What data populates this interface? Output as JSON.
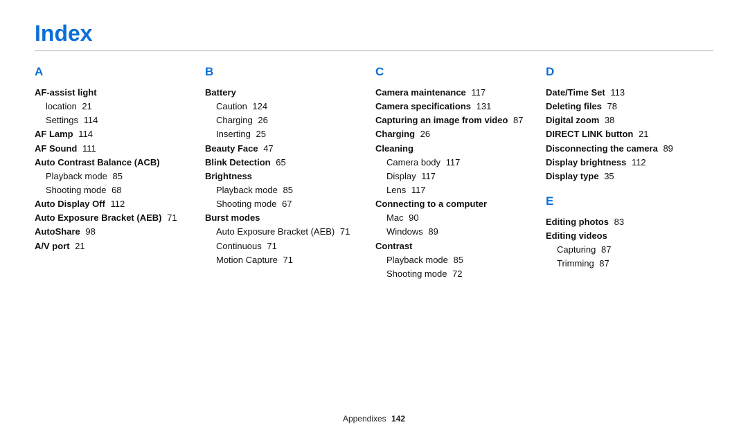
{
  "title": "Index",
  "footer": {
    "section": "Appendixes",
    "page": "142"
  },
  "columns": [
    {
      "letter": "A",
      "entries": [
        {
          "label": "AF-assist light",
          "page": null,
          "subs": [
            {
              "label": "location",
              "page": "21"
            },
            {
              "label": "Settings",
              "page": "114"
            }
          ]
        },
        {
          "label": "AF Lamp",
          "page": "114"
        },
        {
          "label": "AF Sound",
          "page": "111"
        },
        {
          "label": "Auto Contrast Balance (ACB)",
          "page": null,
          "subs": [
            {
              "label": "Playback mode",
              "page": "85"
            },
            {
              "label": "Shooting mode",
              "page": "68"
            }
          ]
        },
        {
          "label": "Auto Display Off",
          "page": "112"
        },
        {
          "label": "Auto Exposure Bracket (AEB)",
          "page": "71"
        },
        {
          "label": "AutoShare",
          "page": "98"
        },
        {
          "label": "A/V port",
          "page": "21"
        }
      ]
    },
    {
      "letter": "B",
      "entries": [
        {
          "label": "Battery",
          "page": null,
          "subs": [
            {
              "label": "Caution",
              "page": "124"
            },
            {
              "label": "Charging",
              "page": "26"
            },
            {
              "label": "Inserting",
              "page": "25"
            }
          ]
        },
        {
          "label": "Beauty Face",
          "page": "47"
        },
        {
          "label": "Blink Detection",
          "page": "65"
        },
        {
          "label": "Brightness",
          "page": null,
          "subs": [
            {
              "label": "Playback mode",
              "page": "85"
            },
            {
              "label": "Shooting mode",
              "page": "67"
            }
          ]
        },
        {
          "label": "Burst modes",
          "page": null,
          "subs": [
            {
              "label": "Auto Exposure Bracket (AEB)",
              "page": "71"
            },
            {
              "label": "Continuous",
              "page": "71"
            },
            {
              "label": "Motion Capture",
              "page": "71"
            }
          ]
        }
      ]
    },
    {
      "letter": "C",
      "entries": [
        {
          "label": "Camera maintenance",
          "page": "117"
        },
        {
          "label": "Camera specifications",
          "page": "131"
        },
        {
          "label": "Capturing an image from video",
          "page": "87"
        },
        {
          "label": "Charging",
          "page": "26"
        },
        {
          "label": "Cleaning",
          "page": null,
          "subs": [
            {
              "label": "Camera body",
              "page": "117"
            },
            {
              "label": "Display",
              "page": "117"
            },
            {
              "label": "Lens",
              "page": "117"
            }
          ]
        },
        {
          "label": "Connecting to a computer",
          "page": null,
          "subs": [
            {
              "label": "Mac",
              "page": "90"
            },
            {
              "label": "Windows",
              "page": "89"
            }
          ]
        },
        {
          "label": "Contrast",
          "page": null,
          "subs": [
            {
              "label": "Playback mode",
              "page": "85"
            },
            {
              "label": "Shooting mode",
              "page": "72"
            }
          ]
        }
      ]
    },
    {
      "groups": [
        {
          "letter": "D",
          "entries": [
            {
              "label": "Date/Time Set",
              "page": "113"
            },
            {
              "label": "Deleting files",
              "page": "78"
            },
            {
              "label": "Digital zoom",
              "page": "38"
            },
            {
              "label": "DIRECT LINK button",
              "page": "21"
            },
            {
              "label": "Disconnecting the camera",
              "page": "89"
            },
            {
              "label": "Display brightness",
              "page": "112"
            },
            {
              "label": "Display type",
              "page": "35"
            }
          ]
        },
        {
          "letter": "E",
          "entries": [
            {
              "label": "Editing photos",
              "page": "83"
            },
            {
              "label": "Editing videos",
              "page": null,
              "subs": [
                {
                  "label": "Capturing",
                  "page": "87"
                },
                {
                  "label": "Trimming",
                  "page": "87"
                }
              ]
            }
          ]
        }
      ]
    }
  ]
}
